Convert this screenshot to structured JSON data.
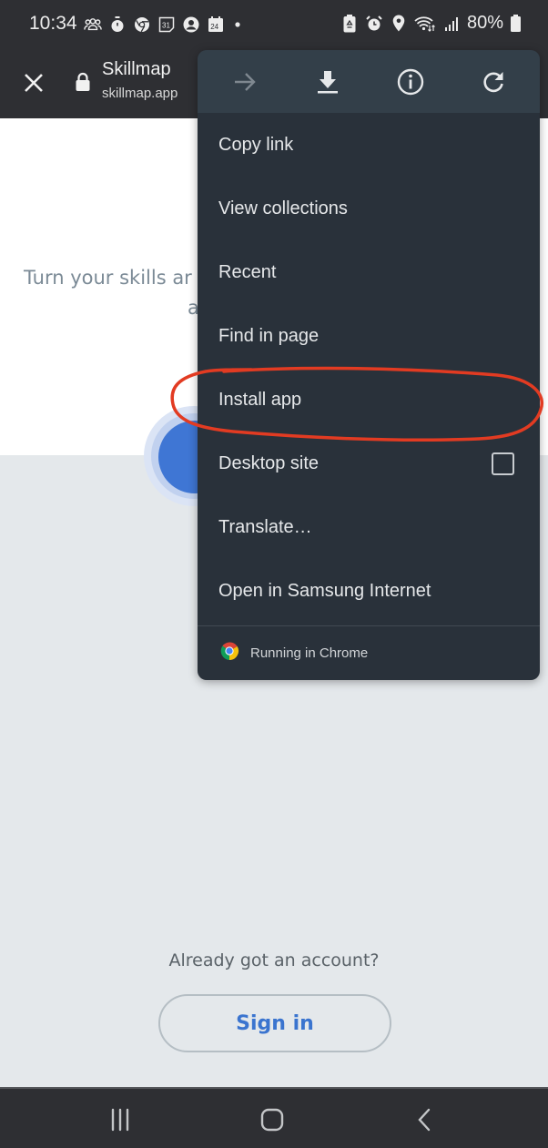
{
  "status_bar": {
    "time": "10:34",
    "left_icons": [
      "people-icon",
      "timer-icon",
      "chrome-icon",
      "calendar-31-icon",
      "account-icon",
      "calendar-24-icon",
      "dot-icon"
    ],
    "calendar_day_a": "31",
    "calendar_day_b": "24",
    "right_icons": [
      "battery-saver-icon",
      "alarm-icon",
      "location-icon",
      "wifi-icon",
      "signal-icon",
      "battery-icon"
    ],
    "battery_percent": "80%"
  },
  "toolbar": {
    "title": "Skillmap",
    "url": "skillmap.app"
  },
  "page": {
    "tagline_line1": "Turn your skills ar",
    "tagline_line2": "a",
    "already_account": "Already got an account?",
    "sign_in_label": "Sign in"
  },
  "menu": {
    "top_actions": [
      {
        "name": "forward",
        "icon": "forward-arrow-icon",
        "enabled": false
      },
      {
        "name": "download",
        "icon": "download-icon",
        "enabled": true
      },
      {
        "name": "page-info",
        "icon": "info-icon",
        "enabled": true
      },
      {
        "name": "reload",
        "icon": "reload-icon",
        "enabled": true
      }
    ],
    "items": [
      {
        "label": "Copy link"
      },
      {
        "label": "View collections"
      },
      {
        "label": "Recent"
      },
      {
        "label": "Find in page"
      },
      {
        "label": "Install app",
        "highlighted": true
      },
      {
        "label": "Desktop site",
        "checkbox": true,
        "checked": false
      },
      {
        "label": "Translate…"
      },
      {
        "label": "Open in Samsung Internet"
      }
    ],
    "footer": "Running in Chrome"
  },
  "colors": {
    "accent_blue": "#3f76d4",
    "annotation_red": "#e23b22",
    "menu_bg": "#29313a"
  },
  "navbar": {
    "buttons": [
      "recents-icon",
      "home-icon",
      "back-icon"
    ]
  }
}
